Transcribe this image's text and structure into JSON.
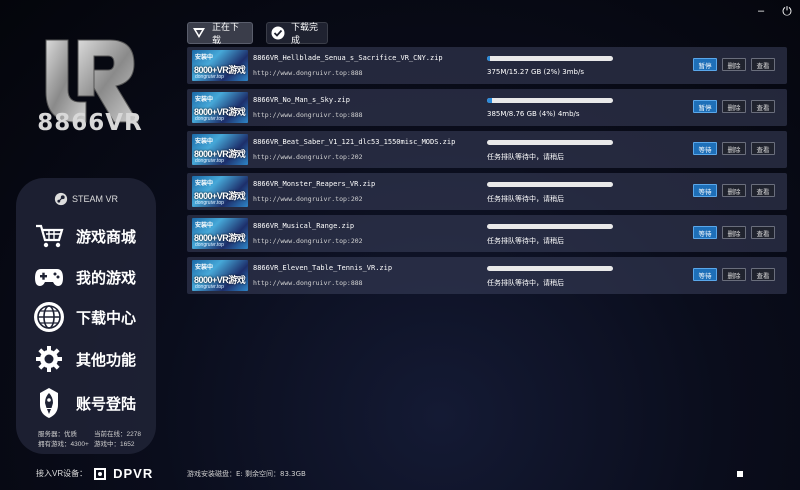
{
  "window": {
    "minimize_glyph": "–",
    "close_glyph": "⏻"
  },
  "logo": {
    "text": "8866VR"
  },
  "sidebar": {
    "steam_label": "STEAM VR",
    "items": [
      {
        "label": "游戏商城",
        "icon": "cart-icon"
      },
      {
        "label": "我的游戏",
        "icon": "gamepad-icon"
      },
      {
        "label": "下载中心",
        "icon": "globe-icon"
      },
      {
        "label": "其他功能",
        "icon": "gear-icon"
      },
      {
        "label": "账号登陆",
        "icon": "rocket-icon"
      }
    ],
    "stats": {
      "server": "服务器：优质",
      "online": "当前在线：2278",
      "games": "拥有游戏：4300+",
      "game_count": "游戏中：1652"
    }
  },
  "device": {
    "label": "接入VR设备：",
    "brand": "DPVR"
  },
  "tabs": [
    {
      "label": "正在下载",
      "active": true
    },
    {
      "label": "下载完成",
      "active": false
    }
  ],
  "thumb": {
    "line1": "安装中",
    "line2": "8000+VR游戏",
    "line3": "dongruivr.top"
  },
  "downloads": [
    {
      "name": "8866VR_Hellblade_Senua_s_Sacrifice_VR_CNY.zip",
      "url": "http://www.dongruivr.top:888",
      "progress": 0.02,
      "status": "375M/15.27 GB (2%) 3mb/s",
      "btn1": "暂停",
      "btn2": "删除",
      "btn3": "查看"
    },
    {
      "name": "8866VR_No_Man_s_Sky.zip",
      "url": "http://www.dongruivr.top:888",
      "progress": 0.04,
      "status": "385M/8.76 GB (4%) 4mb/s",
      "btn1": "暂停",
      "btn2": "删除",
      "btn3": "查看"
    },
    {
      "name": "8866VR_Beat_Saber_V1_121_dlc53_1550misc_MODS.zip",
      "url": "http://www.dongruivr.top:202",
      "progress": 0,
      "status": "任务排队等待中，请稍后",
      "btn1": "等待",
      "btn2": "删除",
      "btn3": "查看"
    },
    {
      "name": "8866VR_Monster_Reapers_VR.zip",
      "url": "http://www.dongruivr.top:202",
      "progress": 0,
      "status": "任务排队等待中，请稍后",
      "btn1": "等待",
      "btn2": "删除",
      "btn3": "查看"
    },
    {
      "name": "8866VR_Musical_Range.zip",
      "url": "http://www.dongruivr.top:202",
      "progress": 0,
      "status": "任务排队等待中，请稍后",
      "btn1": "等待",
      "btn2": "删除",
      "btn3": "查看"
    },
    {
      "name": "8866VR_Eleven_Table_Tennis_VR.zip",
      "url": "http://www.dongruivr.top:888",
      "progress": 0,
      "status": "任务排队等待中，请稍后",
      "btn1": "等待",
      "btn2": "删除",
      "btn3": "查看"
    }
  ],
  "footer": {
    "disk": "游戏安装磁盘：E:   剩余空间：83.3GB"
  },
  "colors": {
    "accent": "#2b8ad9",
    "primary_button": "#1e6fb8",
    "row_bg": "#3c425c"
  }
}
